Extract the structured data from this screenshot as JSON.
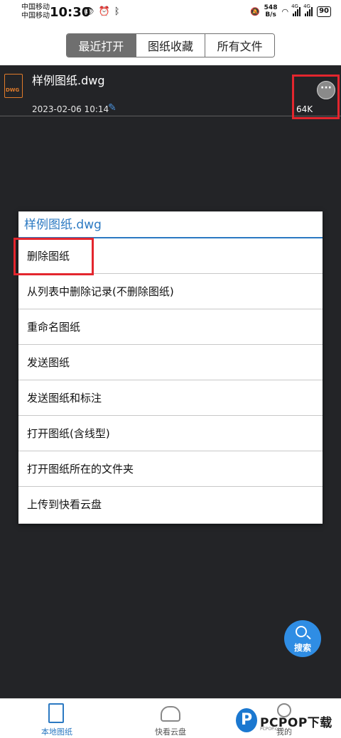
{
  "status_bar": {
    "carrier_1": "中国移动",
    "carrier_2": "中国移动",
    "time": "10:30",
    "speed_value": "548",
    "speed_unit": "B/s",
    "net_1": "4G",
    "net_2": "4G",
    "battery": "90"
  },
  "tabs": [
    {
      "label": "最近打开",
      "active": true
    },
    {
      "label": "图纸收藏",
      "active": false
    },
    {
      "label": "所有文件",
      "active": false
    }
  ],
  "file": {
    "icon_text": "DWG",
    "name": "样例图纸.dwg",
    "date": "2023-02-06 10:14",
    "size": "64K",
    "more_icon": "more-dots-icon"
  },
  "menu": {
    "title": "样例图纸.dwg",
    "items": [
      "删除图纸",
      "从列表中删除记录(不删除图纸)",
      "重命名图纸",
      "发送图纸",
      "发送图纸和标注",
      "打开图纸(含线型)",
      "打开图纸所在的文件夹",
      "上传到快看云盘"
    ]
  },
  "fab": {
    "label": "搜索"
  },
  "bottom_nav": [
    {
      "label": "本地图纸",
      "icon": "document-icon",
      "color": "#2b79c2"
    },
    {
      "label": "快看云盘",
      "icon": "cloud-icon",
      "color": "#888888"
    },
    {
      "label": "我的",
      "icon": "user-icon",
      "color": "#888888"
    }
  ],
  "watermark": {
    "logo": "P",
    "text": "PCPOP下载",
    "sub": "PCPOP.com"
  },
  "colors": {
    "accent": "#2b79c2",
    "highlight": "#e3262e",
    "background": "#232427"
  }
}
